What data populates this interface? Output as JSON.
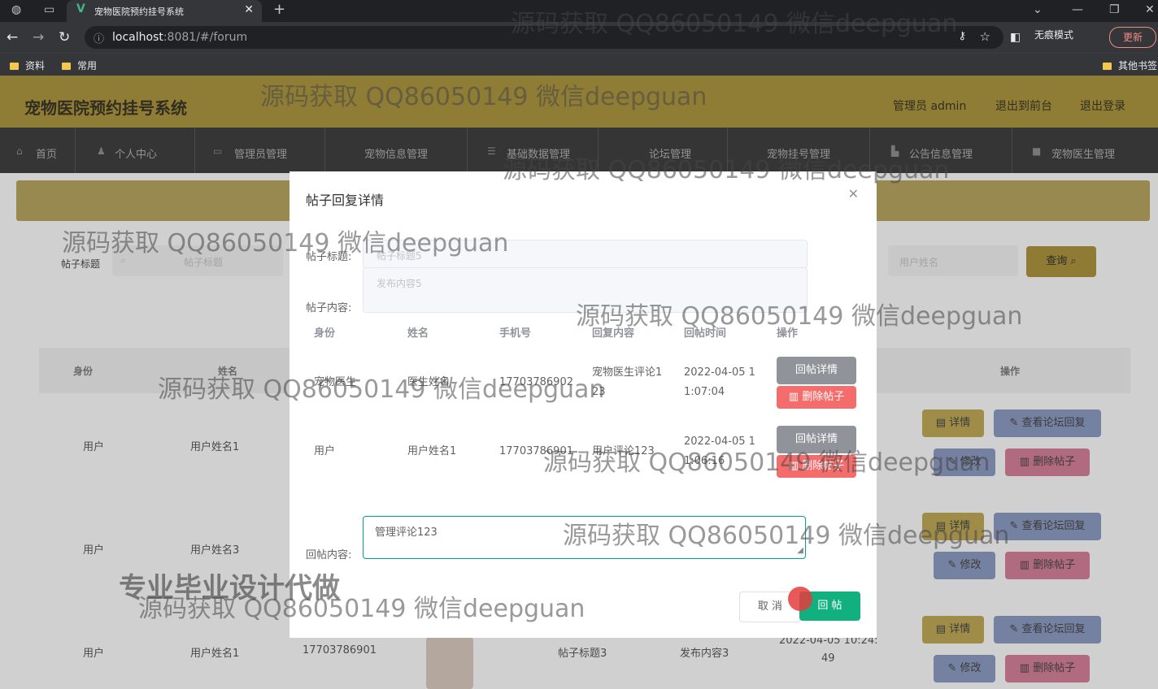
{
  "browser": {
    "tab_title": "宠物医院预约挂号系统",
    "url_host": "localhost",
    "url_rest": ":8081/#/forum",
    "incognito_label": "无痕模式",
    "update_label": "更新",
    "bookmarks": [
      "资料",
      "常用"
    ],
    "other_bookmarks": "其他书签"
  },
  "header": {
    "app_title": "宠物医院预约挂号系统",
    "user_label": "管理员 admin",
    "frontend_label": "退出到前台",
    "logout_label": "退出登录"
  },
  "menu": [
    {
      "label": "首页",
      "icon": "home-icon"
    },
    {
      "label": "个人中心",
      "icon": "user-icon"
    },
    {
      "label": "管理员管理",
      "icon": "admin-icon"
    },
    {
      "label": "宠物信息管理",
      "icon": "pet-icon"
    },
    {
      "label": "基础数据管理",
      "icon": "list-icon"
    },
    {
      "label": "论坛管理",
      "icon": "forum-icon"
    },
    {
      "label": "宠物挂号管理",
      "icon": "register-icon"
    },
    {
      "label": "公告信息管理",
      "icon": "notice-icon"
    },
    {
      "label": "宠物医生管理",
      "icon": "doctor-icon"
    }
  ],
  "search": {
    "label": "帖子标题",
    "placeholder": "帖子标题",
    "placeholder2": "用户姓名",
    "query_label": "查询"
  },
  "table": {
    "headers": [
      "身份",
      "姓名",
      "操作"
    ],
    "rows": [
      {
        "identity": "用户",
        "name": "用户姓名1"
      },
      {
        "identity": "用户",
        "name": "用户姓名3"
      },
      {
        "identity": "用户",
        "name": "用户姓名1",
        "phone": "17703786901",
        "title": "帖子标题3",
        "content": "发布内容3",
        "time_a": "2022-04-05 10:24:",
        "time_b": "49"
      }
    ],
    "actions": {
      "detail": "详情",
      "view_replies": "查看论坛回复",
      "edit": "修改",
      "delete": "删除帖子"
    }
  },
  "modal": {
    "title": "帖子回复详情",
    "post_title_label": "帖子标题:",
    "post_title_value": "帖子标题5",
    "post_content_label": "帖子内容:",
    "post_content_value": "发布内容5",
    "reply_headers": [
      "身份",
      "姓名",
      "手机号",
      "回复内容",
      "回帖时间",
      "操作"
    ],
    "replies": [
      {
        "identity": "宠物医生",
        "name": "医生姓名",
        "phone": "17703786902",
        "content_a": "宠物医生评论1",
        "content_b": "23",
        "time_a": "2022-04-05 1",
        "time_b": "1:07:04"
      },
      {
        "identity": "用户",
        "name": "用户姓名1",
        "phone": "17703786901",
        "content_a": "用户评论123",
        "content_b": "",
        "time_a": "2022-04-05 1",
        "time_b": "1:06:16"
      }
    ],
    "reply_detail_label": "回帖详情",
    "delete_reply_label": "删除帖子",
    "reply_content_label": "回帖内容:",
    "reply_content_value": "管理评论123",
    "cancel_label": "取 消",
    "submit_label": "回 帖"
  },
  "watermarks": {
    "qq": "源码获取 QQ86050149 微信deepguan",
    "ad": "专业毕业设计代做"
  }
}
